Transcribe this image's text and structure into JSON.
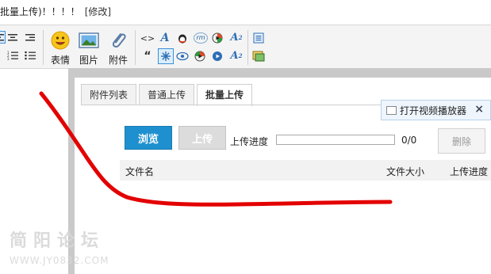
{
  "header": {
    "title_text": "批量上传)！！！！",
    "edit_link": "[修改]"
  },
  "toolbar": {
    "buttons": [
      {
        "label": "表情",
        "icon": "smiley-icon"
      },
      {
        "label": "图片",
        "icon": "image-icon"
      },
      {
        "label": "附件",
        "icon": "paperclip-icon"
      }
    ],
    "small_glyphs": {
      "code": "<>",
      "quote": "“",
      "font_a": "A",
      "sup_a": "A",
      "sup_2": "2",
      "sub_a": "A",
      "sub_2": "2",
      "rm": "rm"
    }
  },
  "upload_panel": {
    "tabs": [
      {
        "label": "附件列表",
        "active": false
      },
      {
        "label": "普通上传",
        "active": false
      },
      {
        "label": "批量上传",
        "active": true
      }
    ],
    "player_button": "打开视频播放器",
    "close_icon": "×",
    "browse_button": "浏览",
    "upload_button": "上传",
    "progress_label": "上传进度",
    "progress_fraction": 0,
    "progress_count": "0/0",
    "delete_button": "删除",
    "columns": {
      "name": "文件名",
      "size": "文件大小",
      "progress": "上传进度"
    }
  },
  "watermark": {
    "title": "简阳论坛",
    "url": "WWW.JY0832.COM"
  },
  "colors": {
    "accent_blue": "#1f90cf",
    "scribble_red": "#e30000",
    "frame_grey": "#c9c9c9"
  }
}
